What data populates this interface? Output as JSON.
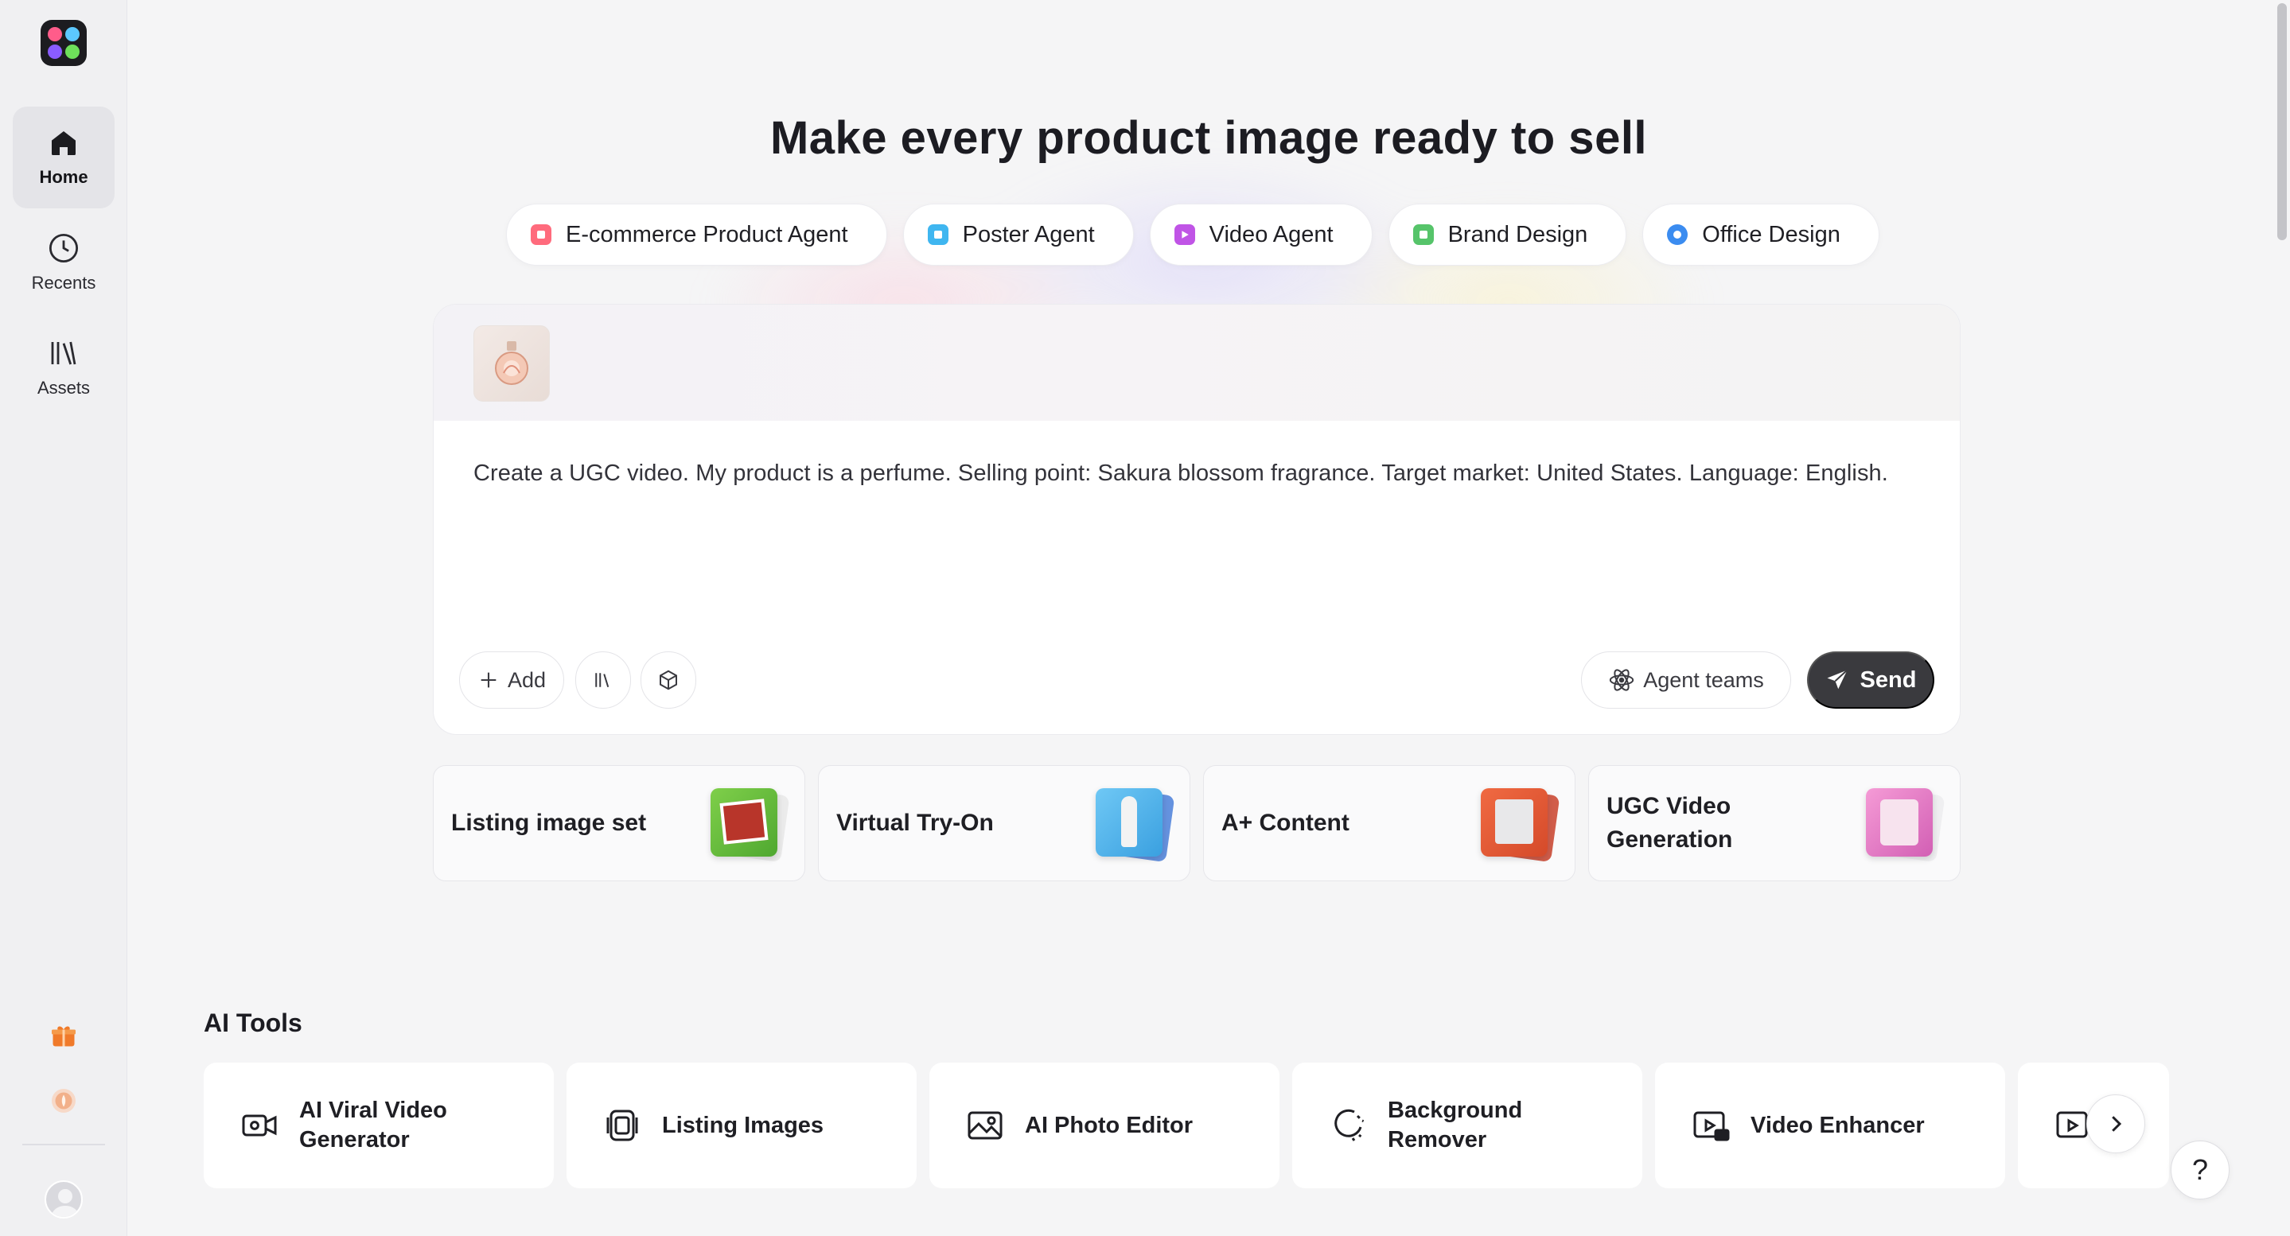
{
  "colors": {
    "accent_dark": "#3a3a3e",
    "logo_pink": "#ff5c8a",
    "logo_blue": "#5cc8ff",
    "logo_purple": "#8a5cff",
    "logo_green": "#6ee05a"
  },
  "sidebar": {
    "items": [
      {
        "label": "Home",
        "icon": "home-icon",
        "active": true
      },
      {
        "label": "Recents",
        "icon": "clock-icon",
        "active": false
      },
      {
        "label": "Assets",
        "icon": "library-icon",
        "active": false
      }
    ]
  },
  "headline": "Make every product image ready to sell",
  "agents": [
    {
      "label": "E-commerce Product Agent",
      "color": "#ff6b7d"
    },
    {
      "label": "Poster Agent",
      "color": "#3fb6f0"
    },
    {
      "label": "Video Agent",
      "color": "#c054e6"
    },
    {
      "label": "Brand Design",
      "color": "#56c46a"
    },
    {
      "label": "Office Design",
      "color": "#3b8cf0"
    }
  ],
  "prompt": {
    "text": "Create a UGC video. My product is a perfume. Selling point: Sakura blossom fragrance. Target market: United States. Language: English.",
    "add_label": "Add",
    "agent_teams_label": "Agent teams",
    "send_label": "Send"
  },
  "features": [
    {
      "label": "Listing image set"
    },
    {
      "label": "Virtual Try-On"
    },
    {
      "label": "A+ Content"
    },
    {
      "label": "UGC Video Generation"
    }
  ],
  "ai_tools": {
    "title": "AI Tools",
    "items": [
      {
        "label": "AI Viral Video Generator",
        "icon": "video-camera-icon"
      },
      {
        "label": "Listing Images",
        "icon": "image-stack-icon"
      },
      {
        "label": "AI Photo Editor",
        "icon": "photo-icon"
      },
      {
        "label": "Background Remover",
        "icon": "remove-bg-icon"
      },
      {
        "label": "Video Enhancer",
        "icon": "hd-video-icon"
      }
    ]
  },
  "help_label": "?"
}
